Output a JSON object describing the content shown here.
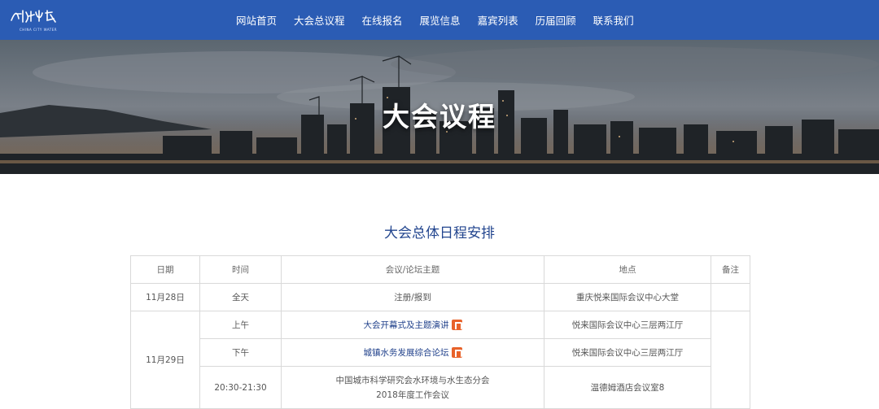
{
  "logo": {
    "text": "城市水世界",
    "subtext": "CHINA CITY WATER"
  },
  "nav": {
    "items": [
      "网站首页",
      "大会总议程",
      "在线报名",
      "展览信息",
      "嘉宾列表",
      "历届回顾",
      "联系我们"
    ]
  },
  "hero": {
    "title": "大会议程"
  },
  "section": {
    "title": "大会总体日程安排"
  },
  "table": {
    "headers": [
      "日期",
      "时间",
      "会议/论坛主题",
      "地点",
      "备注"
    ],
    "rows": [
      {
        "date": "11月28日",
        "time": "全天",
        "topic": "注册/报到",
        "location": "重庆悦来国际会议中心大堂"
      },
      {
        "date": "11月29日",
        "time": "上午",
        "topic": "大会开幕式及主题演讲",
        "location": "悦来国际会议中心三层两江厅"
      },
      {
        "time": "下午",
        "topic": "城镇水务发展综合论坛",
        "location": "悦来国际会议中心三层两江厅"
      },
      {
        "time": "20:30-21:30",
        "topic_line1": "中国城市科学研究会水环境与水生态分会",
        "topic_line2": "2018年度工作会议",
        "location": "温德姆酒店会议室8"
      }
    ]
  },
  "colors": {
    "header": "#2b5cb4",
    "title": "#23468f",
    "ppt": "#e8622a"
  }
}
